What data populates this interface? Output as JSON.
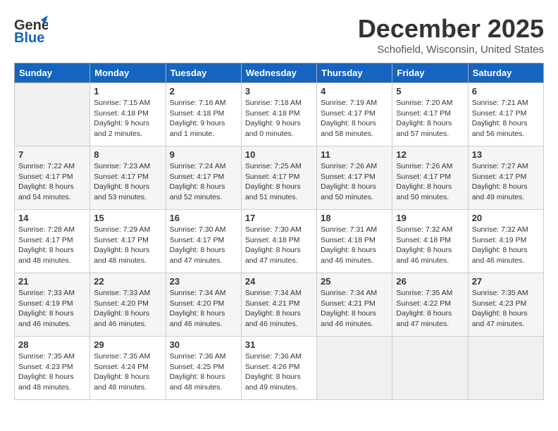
{
  "header": {
    "logo_line1": "General",
    "logo_line2": "Blue",
    "month": "December 2025",
    "location": "Schofield, Wisconsin, United States"
  },
  "weekdays": [
    "Sunday",
    "Monday",
    "Tuesday",
    "Wednesday",
    "Thursday",
    "Friday",
    "Saturday"
  ],
  "weeks": [
    [
      {
        "day": "",
        "empty": true
      },
      {
        "day": "1",
        "sunrise": "7:15 AM",
        "sunset": "4:18 PM",
        "daylight": "9 hours and 2 minutes."
      },
      {
        "day": "2",
        "sunrise": "7:16 AM",
        "sunset": "4:18 PM",
        "daylight": "9 hours and 1 minute."
      },
      {
        "day": "3",
        "sunrise": "7:18 AM",
        "sunset": "4:18 PM",
        "daylight": "9 hours and 0 minutes."
      },
      {
        "day": "4",
        "sunrise": "7:19 AM",
        "sunset": "4:17 PM",
        "daylight": "8 hours and 58 minutes."
      },
      {
        "day": "5",
        "sunrise": "7:20 AM",
        "sunset": "4:17 PM",
        "daylight": "8 hours and 57 minutes."
      },
      {
        "day": "6",
        "sunrise": "7:21 AM",
        "sunset": "4:17 PM",
        "daylight": "8 hours and 56 minutes."
      }
    ],
    [
      {
        "day": "7",
        "sunrise": "7:22 AM",
        "sunset": "4:17 PM",
        "daylight": "8 hours and 54 minutes."
      },
      {
        "day": "8",
        "sunrise": "7:23 AM",
        "sunset": "4:17 PM",
        "daylight": "8 hours and 53 minutes."
      },
      {
        "day": "9",
        "sunrise": "7:24 AM",
        "sunset": "4:17 PM",
        "daylight": "8 hours and 52 minutes."
      },
      {
        "day": "10",
        "sunrise": "7:25 AM",
        "sunset": "4:17 PM",
        "daylight": "8 hours and 51 minutes."
      },
      {
        "day": "11",
        "sunrise": "7:26 AM",
        "sunset": "4:17 PM",
        "daylight": "8 hours and 50 minutes."
      },
      {
        "day": "12",
        "sunrise": "7:26 AM",
        "sunset": "4:17 PM",
        "daylight": "8 hours and 50 minutes."
      },
      {
        "day": "13",
        "sunrise": "7:27 AM",
        "sunset": "4:17 PM",
        "daylight": "8 hours and 49 minutes."
      }
    ],
    [
      {
        "day": "14",
        "sunrise": "7:28 AM",
        "sunset": "4:17 PM",
        "daylight": "8 hours and 48 minutes."
      },
      {
        "day": "15",
        "sunrise": "7:29 AM",
        "sunset": "4:17 PM",
        "daylight": "8 hours and 48 minutes."
      },
      {
        "day": "16",
        "sunrise": "7:30 AM",
        "sunset": "4:17 PM",
        "daylight": "8 hours and 47 minutes."
      },
      {
        "day": "17",
        "sunrise": "7:30 AM",
        "sunset": "4:18 PM",
        "daylight": "8 hours and 47 minutes."
      },
      {
        "day": "18",
        "sunrise": "7:31 AM",
        "sunset": "4:18 PM",
        "daylight": "8 hours and 46 minutes."
      },
      {
        "day": "19",
        "sunrise": "7:32 AM",
        "sunset": "4:18 PM",
        "daylight": "8 hours and 46 minutes."
      },
      {
        "day": "20",
        "sunrise": "7:32 AM",
        "sunset": "4:19 PM",
        "daylight": "8 hours and 46 minutes."
      }
    ],
    [
      {
        "day": "21",
        "sunrise": "7:33 AM",
        "sunset": "4:19 PM",
        "daylight": "8 hours and 46 minutes."
      },
      {
        "day": "22",
        "sunrise": "7:33 AM",
        "sunset": "4:20 PM",
        "daylight": "8 hours and 46 minutes."
      },
      {
        "day": "23",
        "sunrise": "7:34 AM",
        "sunset": "4:20 PM",
        "daylight": "8 hours and 46 minutes."
      },
      {
        "day": "24",
        "sunrise": "7:34 AM",
        "sunset": "4:21 PM",
        "daylight": "8 hours and 46 minutes."
      },
      {
        "day": "25",
        "sunrise": "7:34 AM",
        "sunset": "4:21 PM",
        "daylight": "8 hours and 46 minutes."
      },
      {
        "day": "26",
        "sunrise": "7:35 AM",
        "sunset": "4:22 PM",
        "daylight": "8 hours and 47 minutes."
      },
      {
        "day": "27",
        "sunrise": "7:35 AM",
        "sunset": "4:23 PM",
        "daylight": "8 hours and 47 minutes."
      }
    ],
    [
      {
        "day": "28",
        "sunrise": "7:35 AM",
        "sunset": "4:23 PM",
        "daylight": "8 hours and 48 minutes."
      },
      {
        "day": "29",
        "sunrise": "7:35 AM",
        "sunset": "4:24 PM",
        "daylight": "8 hours and 48 minutes."
      },
      {
        "day": "30",
        "sunrise": "7:36 AM",
        "sunset": "4:25 PM",
        "daylight": "8 hours and 48 minutes."
      },
      {
        "day": "31",
        "sunrise": "7:36 AM",
        "sunset": "4:26 PM",
        "daylight": "8 hours and 49 minutes."
      },
      {
        "day": "",
        "empty": true
      },
      {
        "day": "",
        "empty": true
      },
      {
        "day": "",
        "empty": true
      }
    ]
  ]
}
